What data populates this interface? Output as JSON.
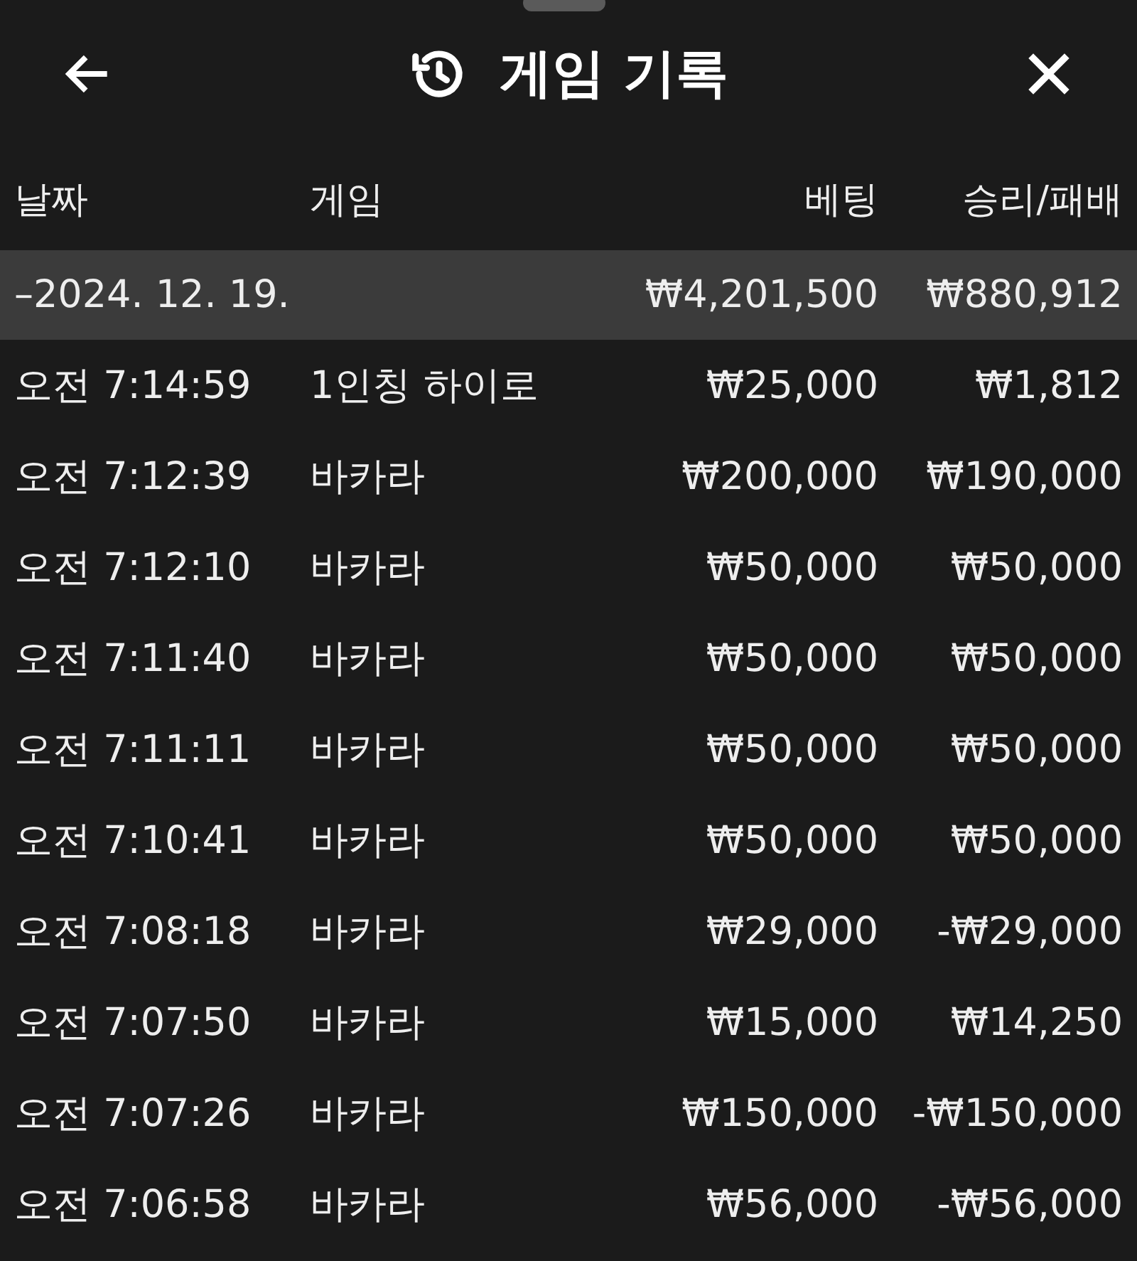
{
  "header": {
    "title": "게임 기록"
  },
  "table": {
    "columns": [
      "날짜",
      "게임",
      "베팅",
      "승리/패배"
    ],
    "group": {
      "date": "–2024. 12. 19.",
      "bet": "₩4,201,500",
      "result": "₩880,912"
    },
    "rows": [
      {
        "time": "오전 7:14:59",
        "game": "1인칭 하이로",
        "bet": "₩25,000",
        "result": "₩1,812"
      },
      {
        "time": "오전 7:12:39",
        "game": "바카라",
        "bet": "₩200,000",
        "result": "₩190,000"
      },
      {
        "time": "오전 7:12:10",
        "game": "바카라",
        "bet": "₩50,000",
        "result": "₩50,000"
      },
      {
        "time": "오전 7:11:40",
        "game": "바카라",
        "bet": "₩50,000",
        "result": "₩50,000"
      },
      {
        "time": "오전 7:11:11",
        "game": "바카라",
        "bet": "₩50,000",
        "result": "₩50,000"
      },
      {
        "time": "오전 7:10:41",
        "game": "바카라",
        "bet": "₩50,000",
        "result": "₩50,000"
      },
      {
        "time": "오전 7:08:18",
        "game": "바카라",
        "bet": "₩29,000",
        "result": "-₩29,000"
      },
      {
        "time": "오전 7:07:50",
        "game": "바카라",
        "bet": "₩15,000",
        "result": "₩14,250"
      },
      {
        "time": "오전 7:07:26",
        "game": "바카라",
        "bet": "₩150,000",
        "result": "-₩150,000"
      },
      {
        "time": "오전 7:06:58",
        "game": "바카라",
        "bet": "₩56,000",
        "result": "-₩56,000"
      }
    ]
  }
}
